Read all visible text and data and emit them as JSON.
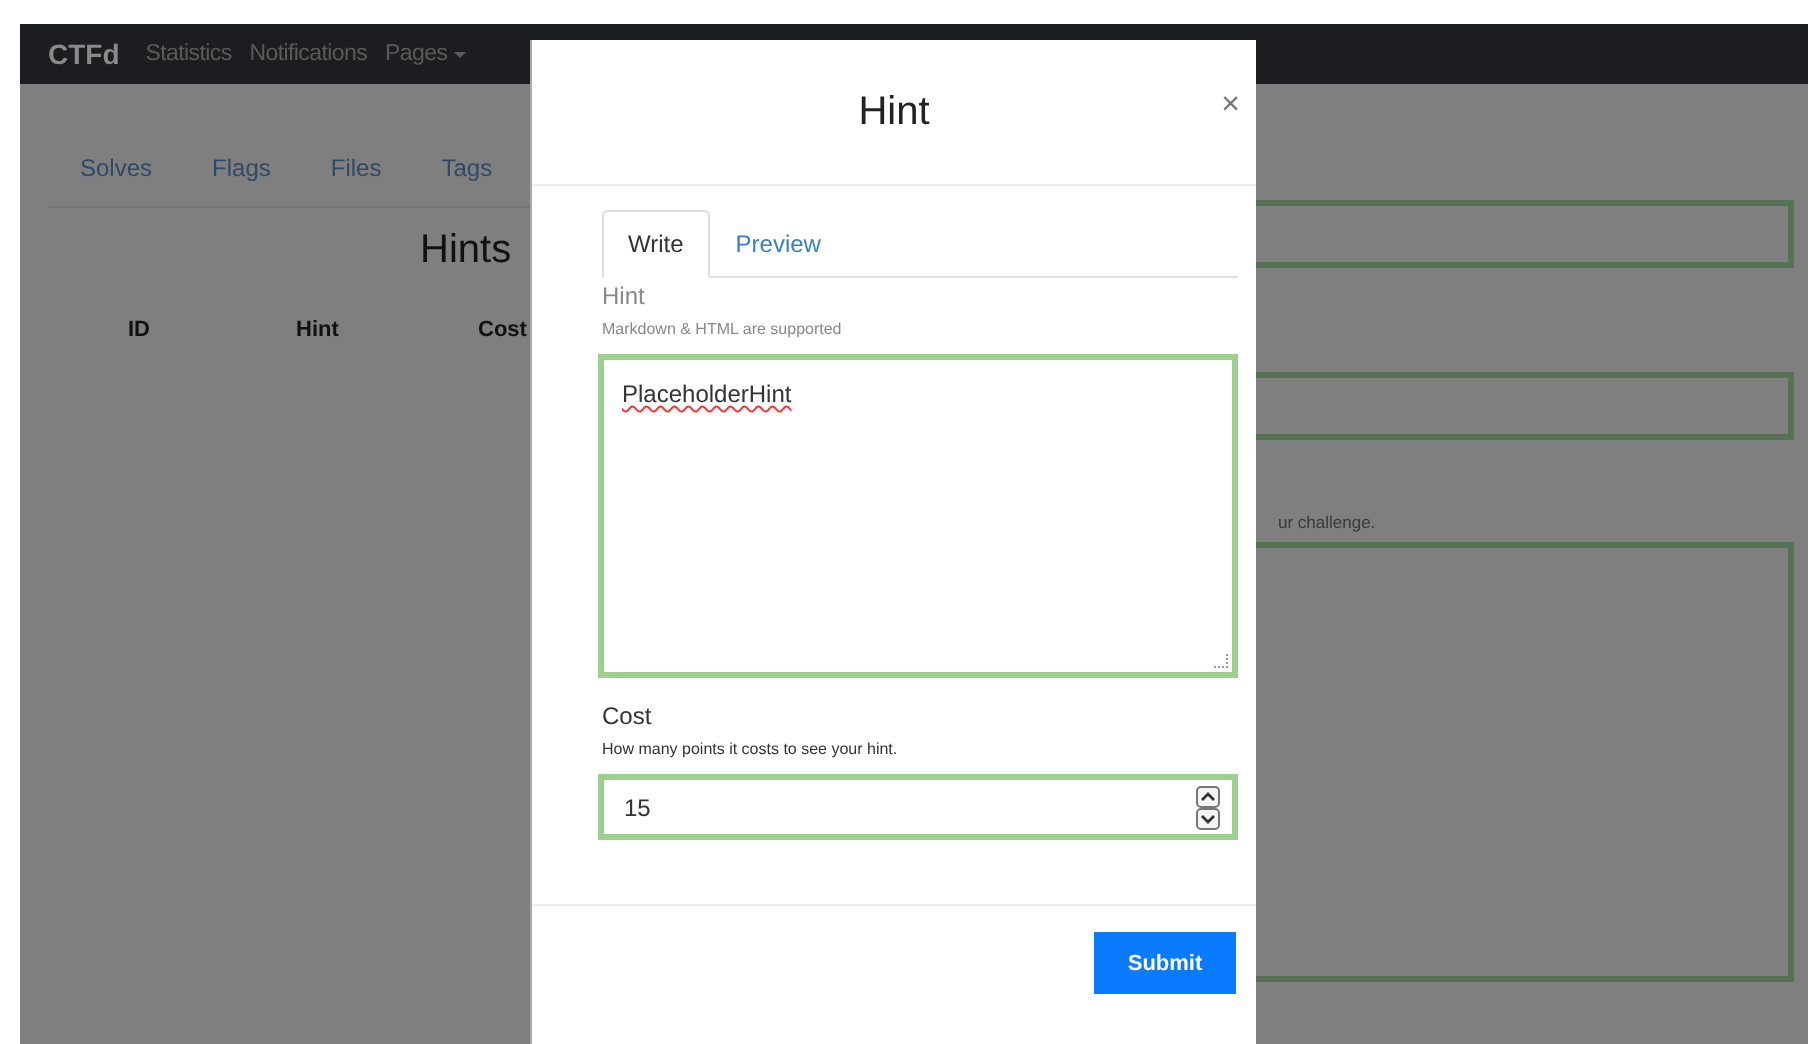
{
  "navbar": {
    "brand": "CTFd",
    "items": [
      {
        "label": "Statistics",
        "dropdown": false
      },
      {
        "label": "Notifications",
        "dropdown": false
      },
      {
        "label": "Pages",
        "dropdown": true
      }
    ]
  },
  "page": {
    "tabs": [
      "Solves",
      "Flags",
      "Files",
      "Tags"
    ],
    "heading": "Hints",
    "columns": [
      "ID",
      "Hint",
      "Cost"
    ],
    "description_label_fragment": "ur challenge."
  },
  "modal": {
    "title": "Hint",
    "close": "×",
    "tabs": [
      {
        "label": "Write",
        "selected": true
      },
      {
        "label": "Preview",
        "selected": false
      }
    ],
    "hint_label": "Hint",
    "hint_help": "Markdown & HTML are supported",
    "hint_value": "PlaceholderHint",
    "cost_label": "Cost",
    "cost_help": "How many points it costs to see your hint.",
    "cost_value": "15",
    "submit": "Submit"
  }
}
